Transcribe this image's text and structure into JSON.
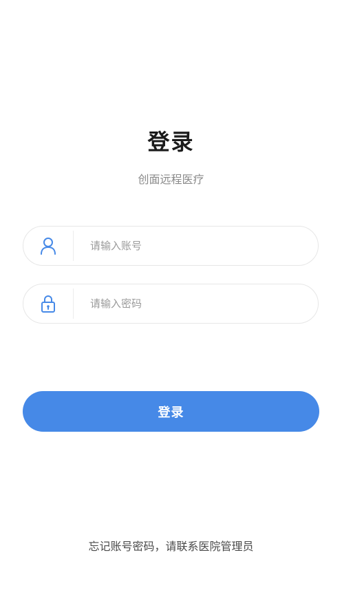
{
  "page": {
    "title": "登录",
    "subtitle": "创面远程医疗"
  },
  "form": {
    "account": {
      "icon": "user-icon",
      "placeholder": "请输入账号",
      "value": ""
    },
    "password": {
      "icon": "lock-icon",
      "placeholder": "请输入密码",
      "value": ""
    },
    "submit_label": "登录"
  },
  "footer": {
    "note": "忘记账号密码，请联系医院管理员"
  },
  "colors": {
    "primary": "#4689e7",
    "icon": "#4689e7",
    "border": "#e6e6e6",
    "placeholder": "#9a9a9a"
  }
}
